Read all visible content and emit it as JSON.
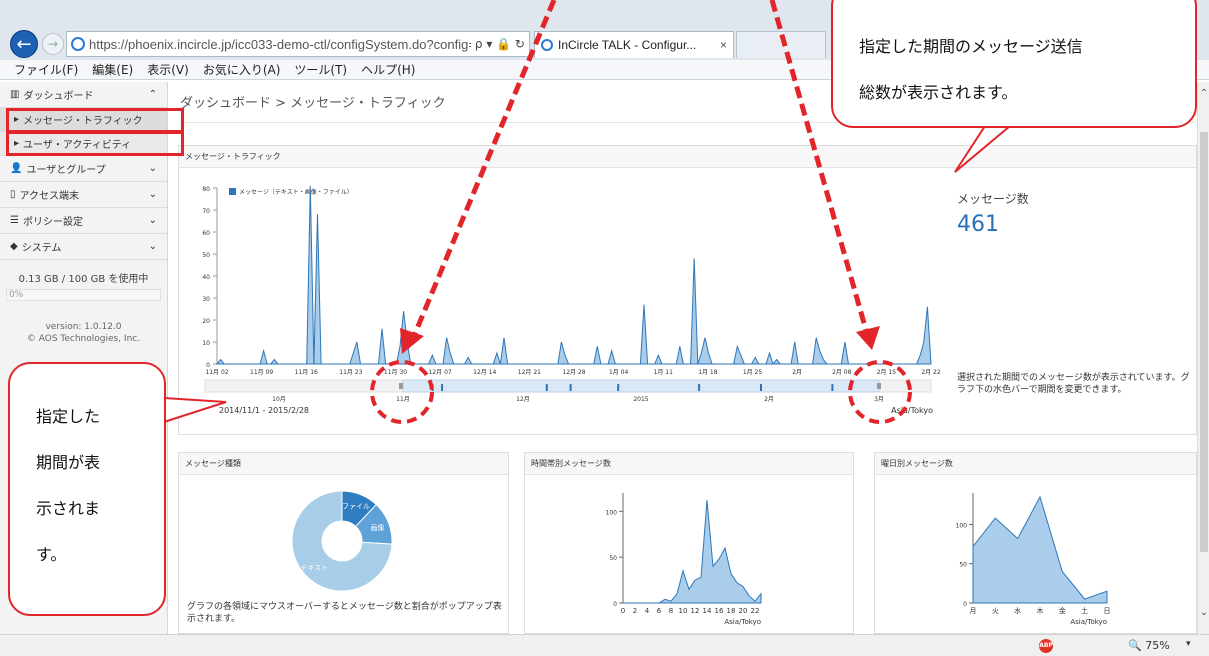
{
  "browser": {
    "url": "https://phoenix.incircle.jp/icc033-demo-ctl/configSystem.do?config=dash",
    "url_tools": "ρ ▾ 🔒 ↻",
    "tab_title": "InCircle TALK - Configur...",
    "tab_close": "×",
    "back_glyph": "←",
    "forward_glyph": "→",
    "menu": [
      "ファイル(F)",
      "編集(E)",
      "表示(V)",
      "お気に入り(A)",
      "ツール(T)",
      "ヘルプ(H)"
    ],
    "zoom": "🔍 75%",
    "zoom_arrow": "▾",
    "adblock_label": "ABP"
  },
  "sidebar": {
    "dashboard": {
      "icon": "bar-chart-icon",
      "label": "ダッシュボード",
      "chevron": "⌃"
    },
    "sub_items": [
      {
        "label": "メッセージ・トラフィック"
      },
      {
        "label": "ユーザ・アクティビティ"
      }
    ],
    "groups": [
      {
        "icon": "users-icon",
        "glyph": "👤",
        "label": "ユーザとグループ",
        "chevron": "⌄"
      },
      {
        "icon": "device-icon",
        "glyph": "▯",
        "label": "アクセス端末",
        "chevron": "⌄"
      },
      {
        "icon": "policy-icon",
        "glyph": "☰",
        "label": "ポリシー設定",
        "chevron": "⌄"
      },
      {
        "icon": "system-icon",
        "glyph": "◆",
        "label": "システム",
        "chevron": "⌄"
      }
    ],
    "usage_text": "0.13 GB / 100 GB を使用中",
    "usage_percent": "0%",
    "version": "version: 1.0.12.0",
    "copyright": "© AOS Technologies, Inc."
  },
  "main": {
    "breadcrumb": "ダッシュボード > メッセージ・トラフィック",
    "traffic": {
      "title": "メッセージ・トラフィック",
      "count_label": "メッセージ数",
      "count_value": "461",
      "description": "選択された期間でのメッセージ数が表示されています。グラフ下の水色バーで期間を変更できます。",
      "period": "2014/11/1 - 2015/2/28",
      "timezone": "Asia/Tokyo"
    },
    "kind": {
      "title": "メッセージ種類",
      "description": "グラフの各領域にマウスオーバーするとメッセージ数と割合がポップアップ表示されます。"
    },
    "hourly": {
      "title": "時間帯別メッセージ数",
      "timezone": "Asia/Tokyo"
    },
    "weekday": {
      "title": "曜日別メッセージ数",
      "timezone": "Asia/Tokyo"
    }
  },
  "annotations": {
    "top_callout": [
      "指定した期間のメッセージ送信",
      "総数が表示されます。"
    ],
    "left_callout": [
      "指定した",
      "期間が表",
      "示されま",
      "す。"
    ],
    "color": "#e2252b"
  },
  "chart_data": [
    {
      "type": "area",
      "legend": "メッセージ（テキスト・画像・ファイル）",
      "ylim": [
        0,
        80
      ],
      "yticks": [
        0,
        10,
        20,
        30,
        40,
        50,
        60,
        70,
        80
      ],
      "xticks": [
        "11月 02",
        "11月 09",
        "11月 16",
        "11月 23",
        "11月 30",
        "12月 07",
        "12月 14",
        "12月 21",
        "12月 28",
        "1月 04",
        "1月 11",
        "1月 18",
        "1月 25",
        "2月",
        "2月 08",
        "2月 15",
        "2月 22"
      ],
      "values": [
        0,
        2,
        0,
        0,
        0,
        0,
        0,
        0,
        0,
        0,
        0,
        0,
        0,
        6,
        0,
        0,
        2,
        0,
        0,
        0,
        0,
        0,
        0,
        0,
        0,
        0,
        81,
        0,
        68,
        0,
        0,
        0,
        0,
        0,
        0,
        0,
        0,
        0,
        5,
        10,
        0,
        0,
        0,
        0,
        0,
        0,
        16,
        0,
        0,
        0,
        0,
        8,
        24,
        10,
        0,
        0,
        0,
        0,
        0,
        0,
        4,
        0,
        0,
        0,
        12,
        5,
        0,
        0,
        0,
        0,
        3,
        0,
        0,
        0,
        0,
        0,
        0,
        0,
        5,
        0,
        12,
        0,
        0,
        0,
        0,
        0,
        0,
        0,
        0,
        0,
        0,
        0,
        0,
        0,
        0,
        0,
        10,
        4,
        0,
        0,
        0,
        0,
        0,
        0,
        0,
        0,
        8,
        0,
        0,
        0,
        6,
        0,
        0,
        0,
        0,
        0,
        0,
        0,
        0,
        27,
        0,
        0,
        0,
        4,
        0,
        0,
        0,
        0,
        0,
        8,
        0,
        0,
        0,
        48,
        0,
        5,
        12,
        5,
        0,
        0,
        0,
        0,
        0,
        0,
        0,
        8,
        4,
        0,
        0,
        0,
        3,
        0,
        0,
        0,
        5,
        0,
        2,
        0,
        0,
        0,
        0,
        10,
        0,
        0,
        0,
        0,
        0,
        12,
        6,
        2,
        0,
        0,
        0,
        0,
        0,
        10,
        0,
        0,
        0,
        0,
        0,
        0,
        0,
        0,
        0,
        0,
        0,
        0,
        0,
        0,
        0,
        0,
        0,
        0,
        0,
        0,
        4,
        10,
        26,
        0
      ],
      "navigator_labels": [
        "10月",
        "11月",
        "12月",
        "2015",
        "2月",
        "3月"
      ]
    },
    {
      "type": "pie",
      "slices": [
        {
          "label": "ファイル",
          "value": 12,
          "color": "#2f7cc0"
        },
        {
          "label": "画像",
          "value": 14,
          "color": "#5fa2d8"
        },
        {
          "label": "テキスト",
          "value": 74,
          "color": "#a7cde8"
        }
      ]
    },
    {
      "type": "area",
      "xticks": [
        0,
        2,
        4,
        6,
        8,
        10,
        12,
        14,
        16,
        18,
        20,
        22
      ],
      "yticks": [
        0,
        50,
        100
      ],
      "ylim": [
        0,
        120
      ],
      "values": [
        0,
        0,
        0,
        0,
        0,
        0,
        0,
        4,
        2,
        10,
        35,
        15,
        25,
        28,
        112,
        40,
        48,
        60,
        32,
        22,
        18,
        8,
        2,
        10
      ]
    },
    {
      "type": "area",
      "categories": [
        "月",
        "火",
        "水",
        "木",
        "金",
        "土",
        "日"
      ],
      "yticks": [
        0,
        50,
        100
      ],
      "ylim": [
        0,
        140
      ],
      "values": [
        72,
        108,
        82,
        135,
        40,
        5,
        15
      ]
    }
  ]
}
